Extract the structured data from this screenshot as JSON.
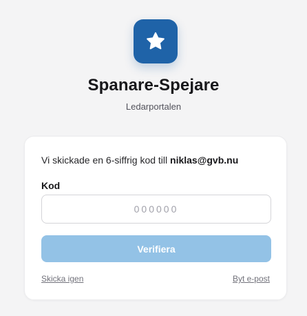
{
  "header": {
    "app_title": "Spanare-Spejare",
    "app_subtitle": "Ledarportalen",
    "logo_icon": "star-icon",
    "brand_color": "#1f63a8"
  },
  "verification": {
    "info_prefix": "Vi skickade en 6-siffrig kod till ",
    "email": "niklas@gvb.nu",
    "code_label": "Kod",
    "code_placeholder": "000000",
    "code_value": "",
    "verify_label": "Verifiera",
    "verify_button_color": "#93c2e6",
    "resend_label": "Skicka igen",
    "change_email_label": "Byt e-post"
  }
}
